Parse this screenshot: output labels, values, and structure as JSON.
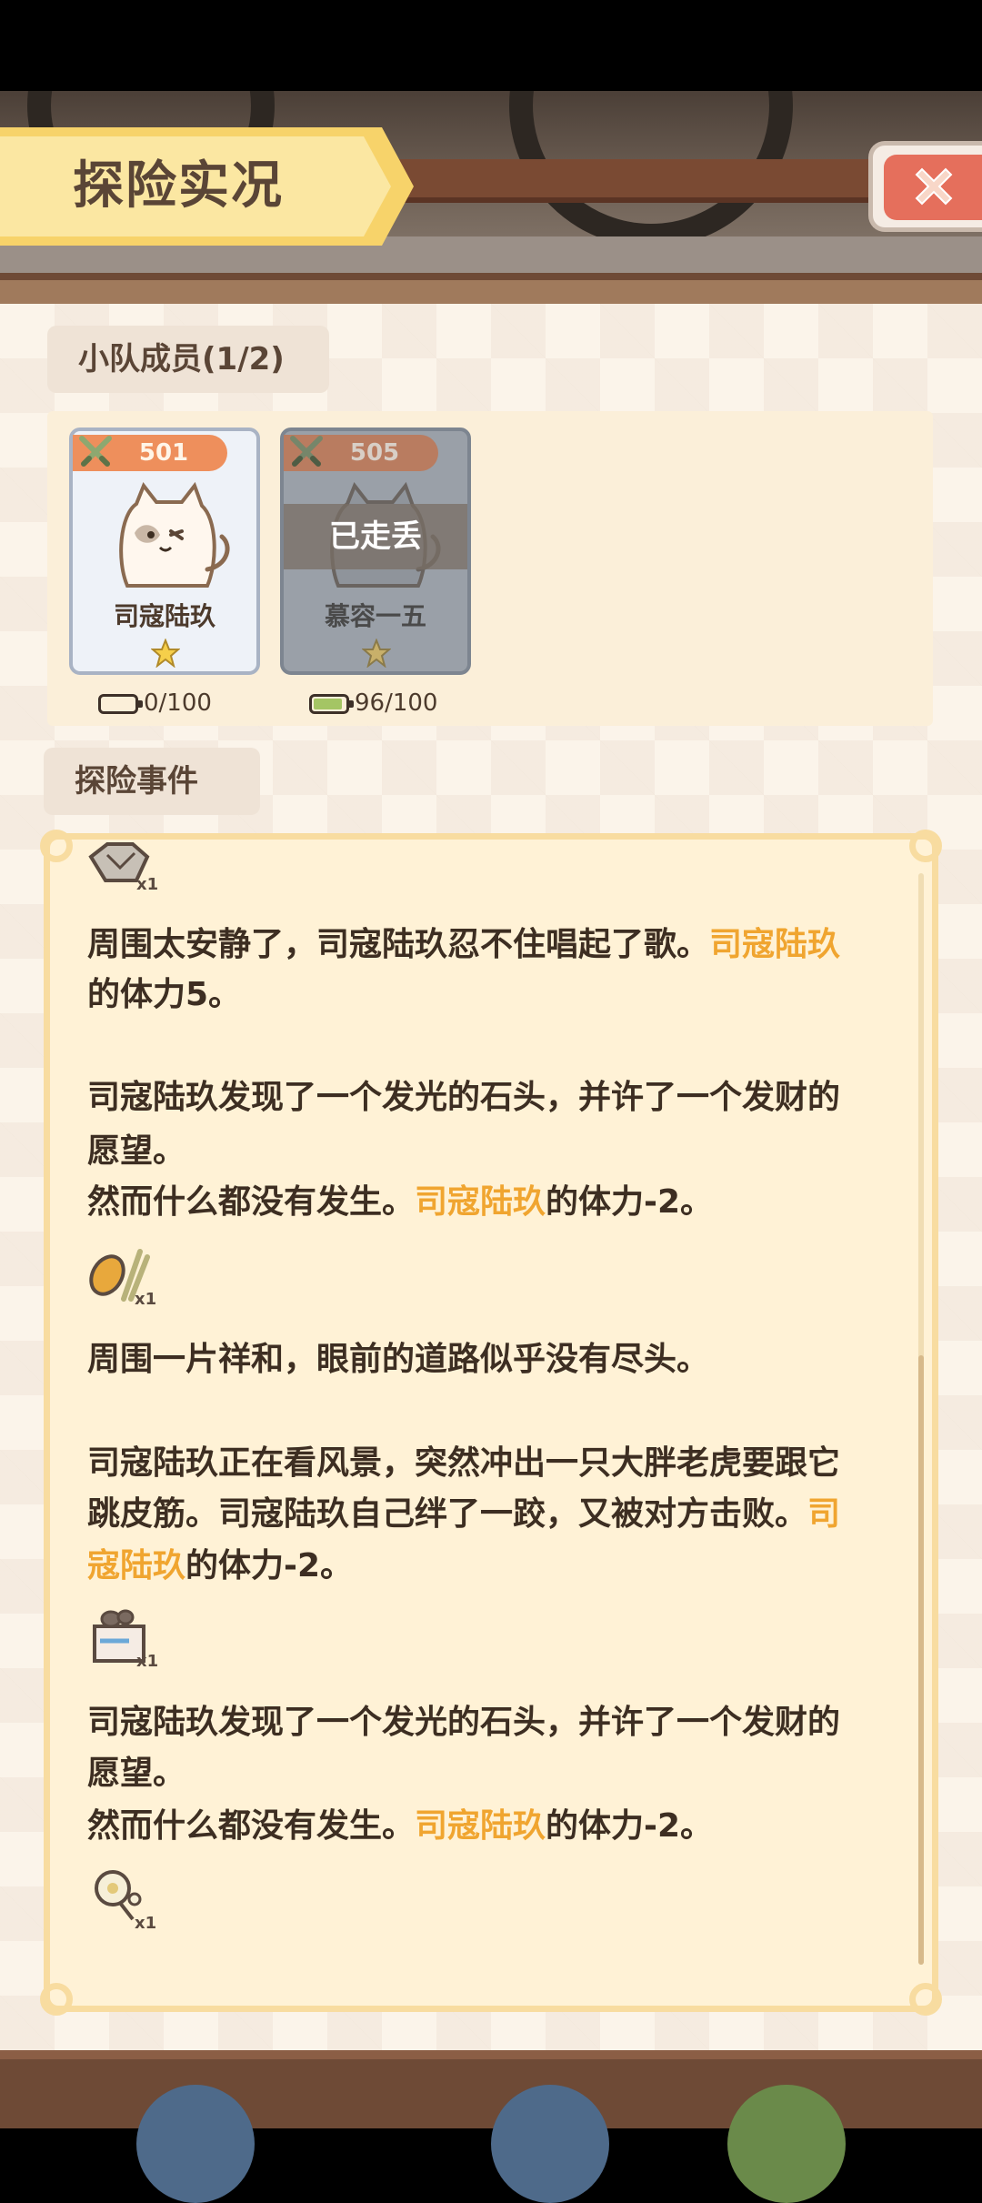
{
  "header": {
    "title": "探险实况"
  },
  "team": {
    "label": "小队成员(1/2)",
    "members": [
      {
        "level": "501",
        "name": "司寇陆玖",
        "status": "",
        "stamina": "0/100",
        "stamina_fraction": 0.0
      },
      {
        "level": "505",
        "name": "慕容一五",
        "status": "已走丢",
        "stamina": "96/100",
        "stamina_fraction": 0.96
      }
    ]
  },
  "events": {
    "label": "探险事件",
    "items": [
      {
        "count": "x1"
      },
      {
        "parts": [
          "周围太安静了，司寇陆玖忍不住唱起了歌。",
          "司寇陆玖"
        ]
      },
      {
        "parts": [
          "的体力5。"
        ]
      },
      {
        "parts": [
          "司寇陆玖发现了一个发光的石头，并许了一个发财的"
        ]
      },
      {
        "parts": [
          "愿望。"
        ]
      },
      {
        "parts": [
          "然而什么都没有发生。",
          "司寇陆玖",
          "的体力-2。"
        ]
      },
      {
        "count": "x1"
      },
      {
        "parts": [
          "周围一片祥和，眼前的道路似乎没有尽头。"
        ]
      },
      {
        "parts": [
          "司寇陆玖正在看风景，突然冲出一只大胖老虎要跟它"
        ]
      },
      {
        "parts": [
          "跳皮筋。司寇陆玖自己绊了一跤，又被对方击败。",
          "司"
        ]
      },
      {
        "parts": [
          "寇陆玖",
          "的体力-2。"
        ]
      },
      {
        "count": "x1"
      },
      {
        "parts": [
          "司寇陆玖发现了一个发光的石头，并许了一个发财的"
        ]
      },
      {
        "parts": [
          "愿望。"
        ]
      },
      {
        "parts": [
          "然而什么都没有发生。",
          "司寇陆玖",
          "的体力-2。"
        ]
      },
      {
        "count": "x1"
      }
    ]
  },
  "colors": {
    "highlight": "#f0a530",
    "text": "#3d2e22",
    "banner": "#f7d36a",
    "close": "#e56f5c"
  },
  "icons": [
    "crossed-swords-icon",
    "cat-icon",
    "star-icon",
    "battery-icon",
    "ore-item-icon",
    "wheat-item-icon",
    "mushroom-crate-item-icon",
    "flower-item-icon",
    "close-icon"
  ]
}
